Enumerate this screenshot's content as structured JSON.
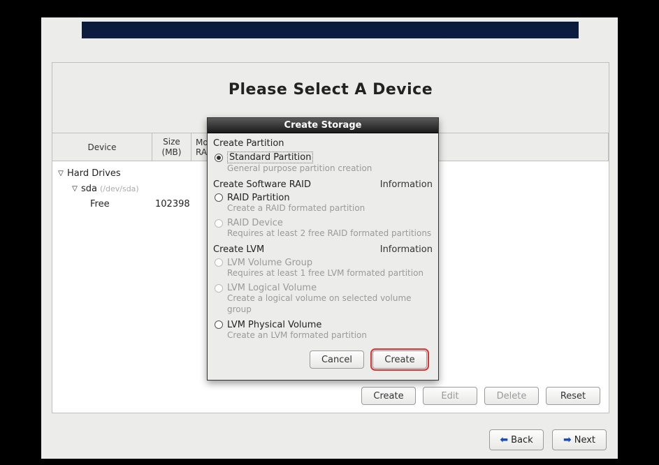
{
  "page": {
    "title": "Please Select A Device"
  },
  "columns": {
    "device": "Device",
    "size_line1": "Size",
    "size_line2": "(MB)",
    "mount_line1": "Mo",
    "mount_line2": "RA"
  },
  "tree": {
    "root": "Hard Drives",
    "disk": "sda",
    "disk_path": "(/dev/sda)",
    "free_label": "Free",
    "free_size": "102398"
  },
  "actions": {
    "create": "Create",
    "edit": "Edit",
    "delete": "Delete",
    "reset": "Reset"
  },
  "nav": {
    "back": "Back",
    "next": "Next"
  },
  "dialog": {
    "title": "Create Storage",
    "sections": {
      "partition": "Create Partition",
      "raid": "Create Software RAID",
      "lvm": "Create LVM",
      "info": "Information"
    },
    "options": {
      "standard": {
        "label": "Standard Partition",
        "hint": "General purpose partition creation"
      },
      "raid_part": {
        "label": "RAID Partition",
        "hint": "Create a RAID formated partition"
      },
      "raid_dev": {
        "label": "RAID Device",
        "hint": "Requires at least 2 free RAID formated partitions"
      },
      "lvm_vg": {
        "label": "LVM Volume Group",
        "hint": "Requires at least 1 free LVM formated partition"
      },
      "lvm_lv": {
        "label": "LVM Logical Volume",
        "hint": "Create a logical volume on selected volume group"
      },
      "lvm_pv": {
        "label": "LVM Physical Volume",
        "hint": "Create an LVM formated partition"
      }
    },
    "buttons": {
      "cancel": "Cancel",
      "create": "Create"
    }
  }
}
